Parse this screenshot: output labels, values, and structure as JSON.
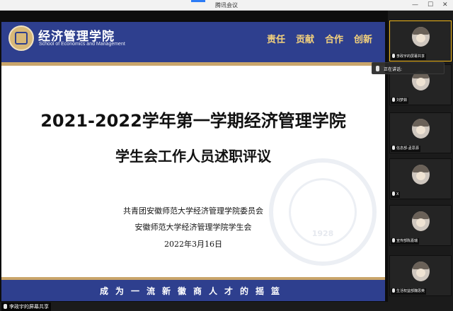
{
  "window": {
    "title": "腾讯会议",
    "controls": {
      "minimize": "—",
      "maximize": "☐",
      "close": "✕"
    }
  },
  "slide": {
    "school_name": "经济管理学院",
    "school_name_en": "School of Economics and Management",
    "motto": [
      "责任",
      "贡献",
      "合作",
      "创新"
    ],
    "title_line1": "2021-2022学年第一学期经济管理学院",
    "title_line2": "学生会工作人员述职评议",
    "org_line1": "共青团安徽师范大学经济管理学院委员会",
    "org_line2": "安徽师范大学经济管理学院学生会",
    "date": "2022年3月16日",
    "seal_year": "1928",
    "footer": "成为一流新徽商人才的摇篮"
  },
  "share_label": "李政宇的屏幕共享",
  "speaking_label": "正在讲话:",
  "participants": [
    {
      "name": "李政宇的屏幕共享",
      "active": true
    },
    {
      "name": "刘梦茹",
      "active": false
    },
    {
      "name": "信息部-孟思源",
      "active": false
    },
    {
      "name": "X",
      "active": false
    },
    {
      "name": "宣传部陈嘉瑞",
      "active": false
    },
    {
      "name": "生活权益部魏思英",
      "active": false
    }
  ],
  "colors": {
    "brand_blue": "#2e3f8e",
    "gold": "#c9a56a",
    "speaker_border": "#f2b81b"
  }
}
